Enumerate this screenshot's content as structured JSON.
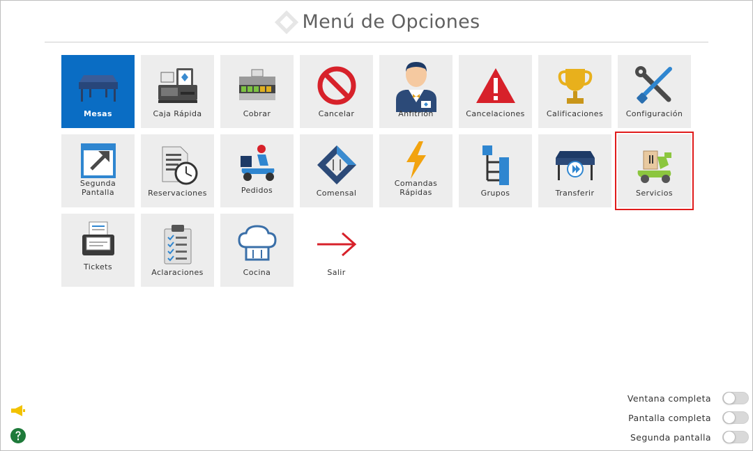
{
  "header": {
    "title": "Menú de Opciones"
  },
  "tiles": [
    {
      "label": "Mesas",
      "icon": "table-icon"
    },
    {
      "label": "Caja Rápida",
      "icon": "cash-register-icon"
    },
    {
      "label": "Cobrar",
      "icon": "cash-drawer-icon"
    },
    {
      "label": "Cancelar",
      "icon": "prohibited-icon"
    },
    {
      "label": "Anfitrión",
      "icon": "host-icon"
    },
    {
      "label": "Cancelaciones",
      "icon": "warning-icon"
    },
    {
      "label": "Calificaciones",
      "icon": "trophy-icon"
    },
    {
      "label": "Configuración",
      "icon": "tools-icon"
    },
    {
      "label": "Segunda Pantalla",
      "icon": "external-window-icon"
    },
    {
      "label": "Reservaciones",
      "icon": "document-clock-icon"
    },
    {
      "label": "Pedidos",
      "icon": "delivery-scooter-icon"
    },
    {
      "label": "Comensal",
      "icon": "diner-icon"
    },
    {
      "label": "Comandas Rápidas",
      "icon": "lightning-icon"
    },
    {
      "label": "Grupos",
      "icon": "hierarchy-icon"
    },
    {
      "label": "Transferir",
      "icon": "table-transfer-icon"
    },
    {
      "label": "Servicios",
      "icon": "service-scooter-icon"
    },
    {
      "label": "Tickets",
      "icon": "ticket-printer-icon"
    },
    {
      "label": "Aclaraciones",
      "icon": "clipboard-checklist-icon"
    },
    {
      "label": "Cocina",
      "icon": "chef-hat-icon"
    },
    {
      "label": "Salir",
      "icon": "arrow-right-icon"
    }
  ],
  "toggles": [
    {
      "label": "Ventana completa",
      "on": false
    },
    {
      "label": "Pantalla completa",
      "on": false
    },
    {
      "label": "Segunda pantalla",
      "on": false
    }
  ],
  "colors": {
    "selected": "#0a6dc4",
    "tile_bg": "#ededed",
    "highlight": "#e01b1b"
  },
  "selected_tile": "Mesas",
  "highlighted_tile": "Servicios"
}
